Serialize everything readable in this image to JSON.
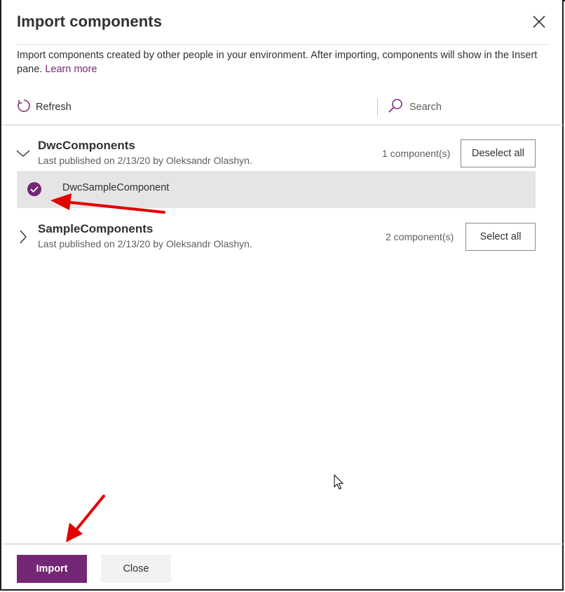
{
  "dialog": {
    "title": "Import components",
    "close_icon": "close-icon",
    "description": "Import components created by other people in your environment. After importing, components will show in the Insert pane.",
    "learn_more": "Learn more"
  },
  "toolbar": {
    "refresh_label": "Refresh",
    "refresh_icon": "refresh-icon",
    "search_placeholder": "Search",
    "search_icon": "search-icon"
  },
  "groups": [
    {
      "name": "DwcComponents",
      "meta": "Last published on 2/13/20 by Oleksandr Olashyn.",
      "count": "1 component(s)",
      "action": "Deselect all",
      "expanded": true,
      "components": [
        {
          "name": "DwcSampleComponent",
          "selected": true
        }
      ]
    },
    {
      "name": "SampleComponents",
      "meta": "Last published on 2/13/20 by Oleksandr Olashyn.",
      "count": "2 component(s)",
      "action": "Select all",
      "expanded": false
    }
  ],
  "footer": {
    "import_label": "Import",
    "close_label": "Close"
  },
  "colors": {
    "accent": "#742774",
    "annotation_arrow": "#e00000",
    "selected_row_bg": "#e5e5e5"
  }
}
